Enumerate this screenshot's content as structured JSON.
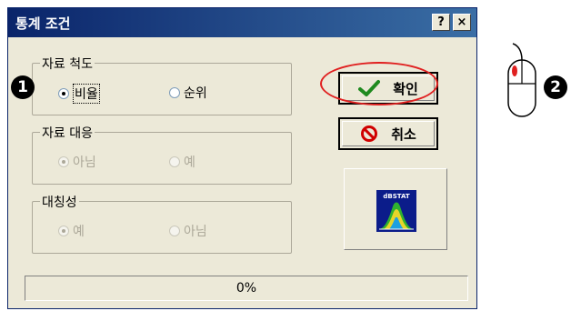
{
  "window": {
    "title": "통계 조건",
    "help_label": "?",
    "close_label": "×"
  },
  "groups": {
    "data_scale": {
      "label": "자료 척도",
      "options": [
        {
          "label": "비율",
          "selected": true
        },
        {
          "label": "순위",
          "selected": false
        }
      ]
    },
    "data_pairing": {
      "label": "자료 대응",
      "options": [
        {
          "label": "아님",
          "selected": true
        },
        {
          "label": "예",
          "selected": false
        }
      ]
    },
    "symmetry": {
      "label": "대칭성",
      "options": [
        {
          "label": "예",
          "selected": true
        },
        {
          "label": "아님",
          "selected": false
        }
      ]
    }
  },
  "buttons": {
    "ok_label": "확인",
    "cancel_label": "취소"
  },
  "logo": {
    "text": "dBSTAT"
  },
  "progress": {
    "label": "0%",
    "value": 0
  },
  "annotations": {
    "marker_1": "1",
    "marker_2": "2"
  },
  "colors": {
    "title_bar": "#0a246a",
    "highlight": "#e02020",
    "check": "#1f8a1f",
    "cancel": "#d00000"
  }
}
